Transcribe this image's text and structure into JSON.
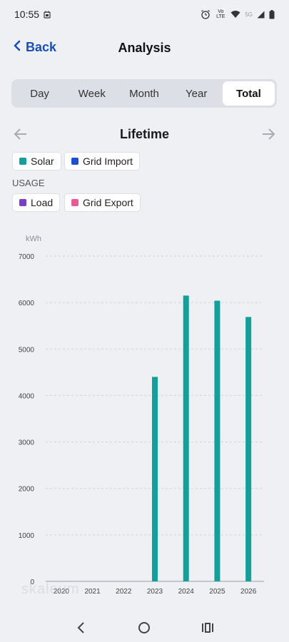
{
  "status": {
    "time": "10:55",
    "network_text": "Vo LTE",
    "signal_text": "5G"
  },
  "header": {
    "back_label": "Back",
    "title": "Analysis"
  },
  "tabs": [
    {
      "label": "Day",
      "active": false
    },
    {
      "label": "Week",
      "active": false
    },
    {
      "label": "Month",
      "active": false
    },
    {
      "label": "Year",
      "active": false
    },
    {
      "label": "Total",
      "active": true
    }
  ],
  "period": {
    "label": "Lifetime"
  },
  "legend": {
    "production": [
      {
        "label": "Solar",
        "color": "#14a09a"
      },
      {
        "label": "Grid Import",
        "color": "#1b4fcb"
      }
    ],
    "usage_label": "USAGE",
    "usage": [
      {
        "label": "Load",
        "color": "#7a3fc7"
      },
      {
        "label": "Grid Export",
        "color": "#e65a9a"
      }
    ]
  },
  "watermark": "skaleum",
  "chart_data": {
    "type": "bar",
    "ylabel": "kWh",
    "ylim": [
      0,
      7000
    ],
    "yticks": [
      0,
      1000,
      2000,
      3000,
      4000,
      5000,
      6000,
      7000
    ],
    "categories": [
      "2020",
      "2021",
      "2022",
      "2023",
      "2024",
      "2025",
      "2026"
    ],
    "series": [
      {
        "name": "Solar",
        "color": "#14a09a",
        "values": [
          0,
          0,
          0,
          4400,
          6150,
          6040,
          5690
        ]
      }
    ],
    "grid": true
  }
}
